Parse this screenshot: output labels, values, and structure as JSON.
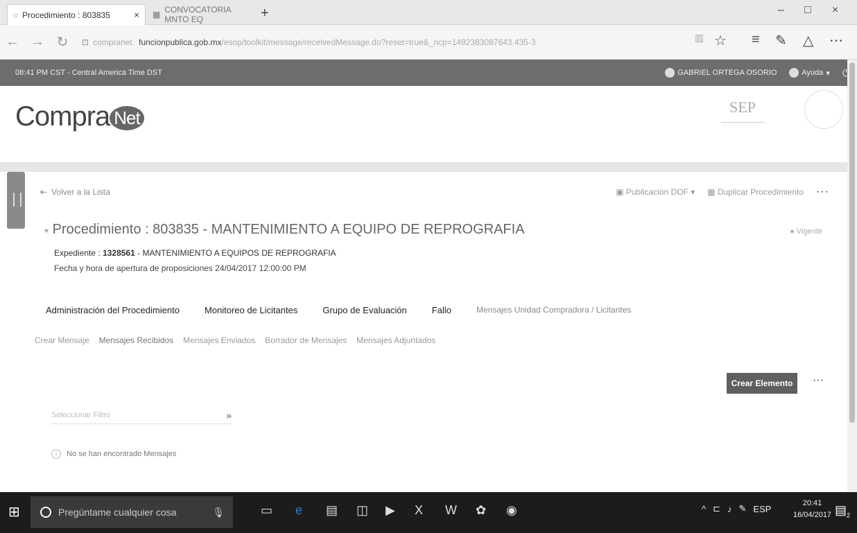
{
  "browser": {
    "tabs": [
      {
        "label": "Procedimiento : 803835",
        "close": "×"
      },
      {
        "label": "CONVOCATORIA MNTO EQ"
      }
    ],
    "new_tab": "+",
    "window_controls": {
      "minimize": "–",
      "maximize": "□",
      "close": "×"
    },
    "nav": {
      "back": "←",
      "forward": "→",
      "refresh": "↻",
      "lock": "🔒"
    },
    "url_prefix": "compranet.",
    "url_domain": "funcionpublica.gob.mx",
    "url_rest": "/esop/toolkit/message/receivedMessage.do?reset=true&_ncp=1492383087643.435-3",
    "toolbar_icons": [
      "reading-view-icon",
      "favorite-icon",
      "hub-icon",
      "note-icon",
      "share-icon",
      "more-icon"
    ]
  },
  "app_header": {
    "time_zone": "08:41 PM CST - Central America Time DST",
    "user": "GABRIEL ORTEGA OSORIO",
    "help": "Ayuda",
    "power": "⏻"
  },
  "brand": {
    "logo_text": "Compra",
    "logo_badge": "Net",
    "sep": "SEP"
  },
  "page": {
    "back_link": "Volver a la Lista",
    "actions": {
      "publicacion": "Publicación DOF",
      "duplicar": "Duplicar Procedimiento",
      "more": "···"
    },
    "title": "Procedimiento : 803835 - MANTENIMIENTO A EQUIPO DE REPROGRAFIA",
    "status": "Vigente",
    "expediente_label": "Expediente :",
    "expediente_num": "1328561",
    "expediente_desc": "MANTENIMIENTO A EQUIPOS DE REPROGRAFIA",
    "fecha": "Fecha y hora de apertura de proposiciones 24/04/2017 12:00:00 PM",
    "main_tabs": [
      "Administración del Procedimiento",
      "Monitoreo de Licitantes",
      "Grupo de Evaluación",
      "Fallo",
      "Mensajes Unidad Compradora / Licitantes"
    ],
    "sub_tabs": [
      "Crear Mensaje",
      "Mensajes Recibidos",
      "Mensajes Enviados",
      "Borrador de Mensajes",
      "Mensajes Adjuntados"
    ],
    "create_button": "Crear Elemento",
    "create_more": "···",
    "filter_placeholder": "Seleccionar Filtro",
    "filter_chevron": "»",
    "empty_message": "No se han encontrado Mensajes"
  },
  "taskbar": {
    "search_placeholder": "Pregúntame cualquier cosa",
    "tray_lang": "ESP",
    "time": "20:41",
    "date": "16/04/2017",
    "notif_count": "2"
  }
}
